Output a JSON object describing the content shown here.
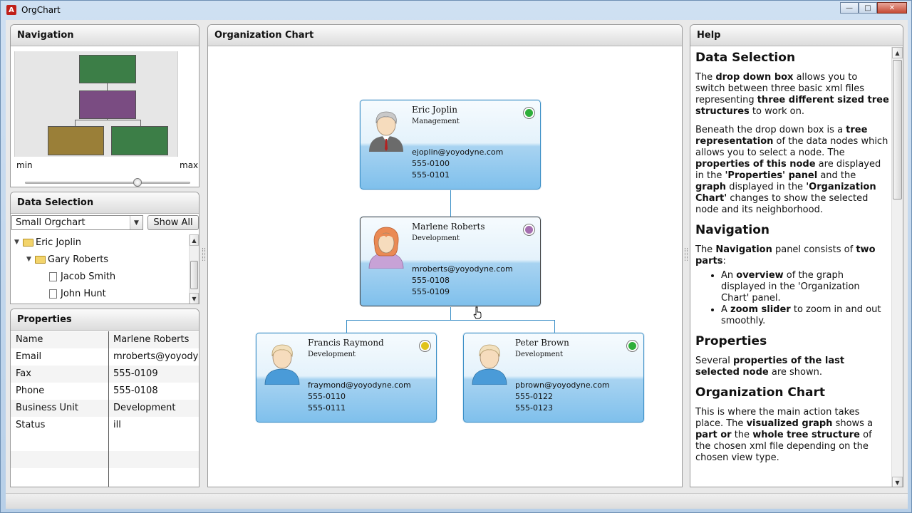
{
  "window": {
    "title": "OrgChart",
    "icon": "app-icon"
  },
  "navigation": {
    "title": "Navigation",
    "min_label": "min",
    "max_label": "max",
    "zoom_slider_level": 0.69
  },
  "data_selection": {
    "title": "Data Selection",
    "dropdown_value": "Small Orgchart",
    "show_all_label": "Show All",
    "tree": [
      {
        "label": "Eric Joplin",
        "type": "folder",
        "depth": 0,
        "expanded": true
      },
      {
        "label": "Gary Roberts",
        "type": "folder",
        "depth": 1,
        "expanded": true
      },
      {
        "label": "Jacob Smith",
        "type": "leaf",
        "depth": 2
      },
      {
        "label": "John Hunt",
        "type": "leaf",
        "depth": 2
      }
    ]
  },
  "properties": {
    "title": "Properties",
    "rows": [
      {
        "key": "Name",
        "value": "Marlene Roberts"
      },
      {
        "key": "Email",
        "value": "mroberts@yoyodyr"
      },
      {
        "key": "Fax",
        "value": "555-0109"
      },
      {
        "key": "Phone",
        "value": "555-0108"
      },
      {
        "key": "Business Unit",
        "value": "Development"
      },
      {
        "key": "Status",
        "value": "ill"
      }
    ]
  },
  "org_chart": {
    "title": "Organization Chart",
    "nodes": [
      {
        "name": "Eric Joplin",
        "unit": "Management",
        "email": "ejoplin@yoyodyne.com",
        "phone1": "555-0100",
        "phone2": "555-0101",
        "status_color": "#2fae3a",
        "avatar": "manager-avatar-icon"
      },
      {
        "name": "Marlene Roberts",
        "unit": "Development",
        "email": "mroberts@yoyodyne.com",
        "phone1": "555-0108",
        "phone2": "555-0109",
        "status_color": "#a56fb0",
        "avatar": "female-avatar-icon"
      },
      {
        "name": "Francis Raymond",
        "unit": "Development",
        "email": "fraymond@yoyodyne.com",
        "phone1": "555-0110",
        "phone2": "555-0111",
        "status_color": "#e0c31a",
        "avatar": "male-avatar-icon"
      },
      {
        "name": "Peter Brown",
        "unit": "Development",
        "email": "pbrown@yoyodyne.com",
        "phone1": "555-0122",
        "phone2": "555-0123",
        "status_color": "#2fae3a",
        "avatar": "male-avatar-icon"
      }
    ]
  },
  "help": {
    "title": "Help",
    "sections": {
      "s1_title": "Data Selection",
      "s2_title": "Navigation",
      "s3_title": "Properties",
      "s4_title": "Organization Chart"
    },
    "text": {
      "p1a": "The ",
      "p1b": "drop down box",
      "p1c": " allows you to switch between three basic xml files representing ",
      "p1d": "three different sized tree structures",
      "p1e": " to work on.",
      "p2a": "Beneath the drop down box is a ",
      "p2b": "tree representation",
      "p2c": " of the data nodes which allows you to select a node. The ",
      "p2d": "properties of this node",
      "p2e": " are displayed in the ",
      "p2f": "'Properties' panel",
      "p2g": " and the ",
      "p2h": "graph",
      "p2i": " displayed in the ",
      "p2j": "'Organization Chart'",
      "p2k": " changes to show the selected node and its neighborhood.",
      "p3a": "The ",
      "p3b": "Navigation",
      "p3c": " panel consists of ",
      "p3d": "two parts",
      "p3e": ":",
      "li1a": "An ",
      "li1b": "overview",
      "li1c": " of the graph displayed in the 'Organization Chart' panel.",
      "li2a": "A ",
      "li2b": "zoom slider",
      "li2c": " to zoom in and out smoothly.",
      "p4a": "Several ",
      "p4b": "properties of the last selected node",
      "p4c": " are shown.",
      "p5a": "This is where the main action takes place. The ",
      "p5b": "visualized graph",
      "p5c": " shows a ",
      "p5d": "part or",
      "p5e": " the ",
      "p5f": "whole tree structure",
      "p5g": " of the chosen xml file depending on the chosen view type."
    }
  }
}
